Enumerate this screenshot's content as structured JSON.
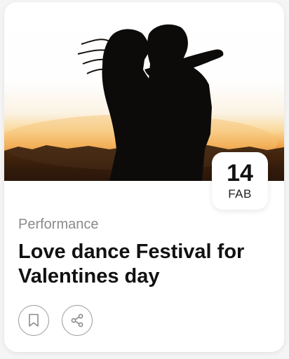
{
  "event": {
    "category": "Performance",
    "title": "Love dance Festival for Valentines day",
    "date": {
      "day": "14",
      "month": "FAB"
    }
  },
  "actions": {
    "bookmark_icon": "bookmark-icon",
    "share_icon": "share-icon"
  },
  "colors": {
    "text_primary": "#111111",
    "text_secondary": "#8a8a8a",
    "icon_border": "#9a9a9a",
    "sunset": "#f2a64b"
  }
}
